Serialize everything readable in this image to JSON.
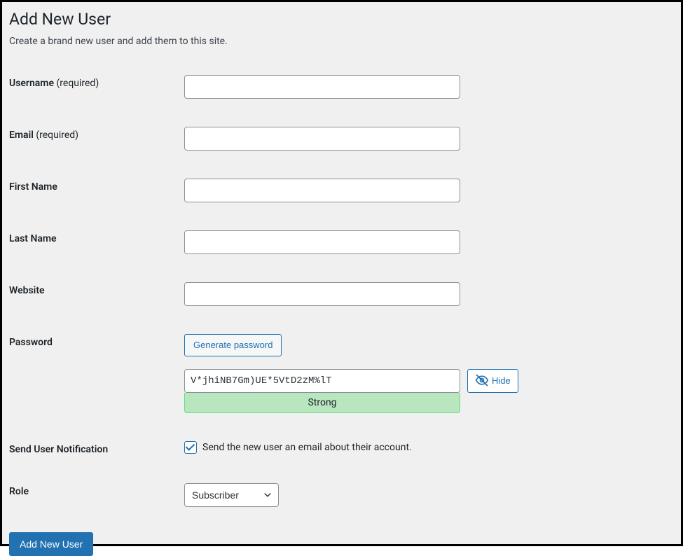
{
  "page": {
    "title": "Add New User",
    "subtitle": "Create a brand new user and add them to this site."
  },
  "fields": {
    "username": {
      "label": "Username",
      "required_text": "(required)",
      "value": ""
    },
    "email": {
      "label": "Email",
      "required_text": "(required)",
      "value": ""
    },
    "first_name": {
      "label": "First Name",
      "value": ""
    },
    "last_name": {
      "label": "Last Name",
      "value": ""
    },
    "website": {
      "label": "Website",
      "value": ""
    },
    "password": {
      "label": "Password",
      "generate_btn": "Generate password",
      "value": "V*jhiNB7Gm)UE*5VtD2zM%lT",
      "strength": "Strong",
      "hide_btn": "Hide"
    },
    "notification": {
      "label": "Send User Notification",
      "checkbox_label": "Send the new user an email about their account.",
      "checked": true
    },
    "role": {
      "label": "Role",
      "selected": "Subscriber"
    }
  },
  "submit": {
    "label": "Add New User"
  }
}
